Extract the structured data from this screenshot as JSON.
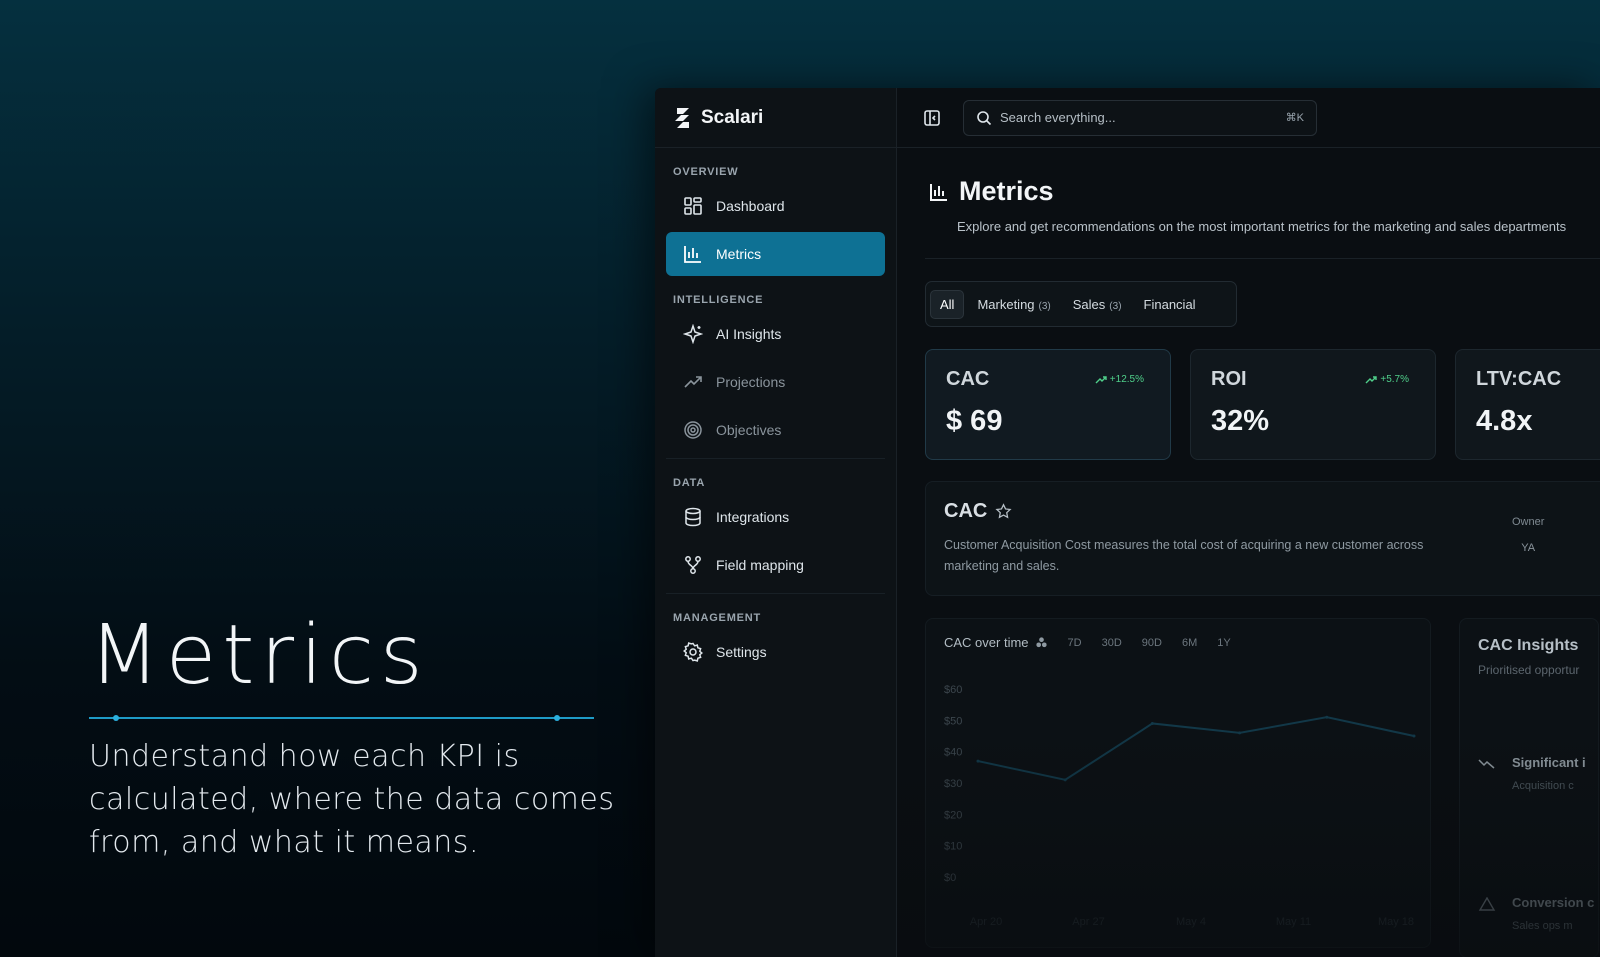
{
  "hero": {
    "title": "Metrics",
    "subtitle": "Understand how each KPI is calculated, where the data comes from, and what it means."
  },
  "app": {
    "brand": "Scalari",
    "search": {
      "placeholder": "Search everything...",
      "shortcut": "⌘K"
    },
    "sidebar": {
      "sections": [
        {
          "label": "OVERVIEW",
          "items": [
            {
              "label": "Dashboard",
              "icon": "grid-icon",
              "active": false
            },
            {
              "label": "Metrics",
              "icon": "bar-chart-icon",
              "active": true
            }
          ]
        },
        {
          "label": "INTELLIGENCE",
          "items": [
            {
              "label": "AI Insights",
              "icon": "sparkle-icon",
              "active": false
            },
            {
              "label": "Projections",
              "icon": "trend-up-icon",
              "active": false
            },
            {
              "label": "Objectives",
              "icon": "target-icon",
              "active": false
            }
          ]
        },
        {
          "label": "DATA",
          "items": [
            {
              "label": "Integrations",
              "icon": "database-icon",
              "active": false
            },
            {
              "label": "Field mapping",
              "icon": "mapping-icon",
              "active": false
            }
          ]
        },
        {
          "label": "MANAGEMENT",
          "items": [
            {
              "label": "Settings",
              "icon": "gear-icon",
              "active": false
            }
          ]
        }
      ]
    },
    "page": {
      "title": "Metrics",
      "description": "Explore and get recommendations on the most important metrics for the marketing and sales departments"
    },
    "tabs": [
      {
        "label": "All",
        "count": "",
        "active": true
      },
      {
        "label": "Marketing",
        "count": "(3)",
        "active": false
      },
      {
        "label": "Sales",
        "count": "(3)",
        "active": false
      },
      {
        "label": "Financial",
        "count": "",
        "active": false
      }
    ],
    "kpis": [
      {
        "label": "CAC",
        "value": "$ 69",
        "delta": "+12.5%"
      },
      {
        "label": "ROI",
        "value": "32%",
        "delta": "+5.7%"
      },
      {
        "label": "LTV:CAC",
        "value": "4.8x",
        "delta": ""
      }
    ],
    "detail": {
      "title": "CAC",
      "description": "Customer Acquisition Cost measures the total cost of acquiring a new customer across marketing and sales.",
      "owner_label": "Owner",
      "owner_initials": "YA"
    },
    "chart": {
      "title": "CAC over time",
      "ranges": [
        "7D",
        "30D",
        "90D",
        "6M",
        "1Y"
      ]
    },
    "insights": {
      "title": "CAC Insights",
      "subtitle": "Prioritised opportur",
      "items": [
        {
          "title": "Significant i",
          "sub": "Acquisition c"
        },
        {
          "title": "Conversion c",
          "sub": "Sales ops m"
        }
      ]
    },
    "colors": {
      "accent": "#0e7194",
      "positive": "#4fcf8a",
      "line": "#123848"
    }
  },
  "chart_data": {
    "type": "line",
    "title": "CAC over time",
    "x": [
      "Apr 20",
      "Apr 27",
      "May 4",
      "May 11",
      "May 18"
    ],
    "series": [
      {
        "values": [
          37,
          31,
          49,
          46,
          51,
          45
        ]
      }
    ],
    "yticks": [
      "$60",
      "$50",
      "$40",
      "$30",
      "$20",
      "$10",
      "$0"
    ],
    "ylim": [
      0,
      60
    ],
    "grid": false
  }
}
